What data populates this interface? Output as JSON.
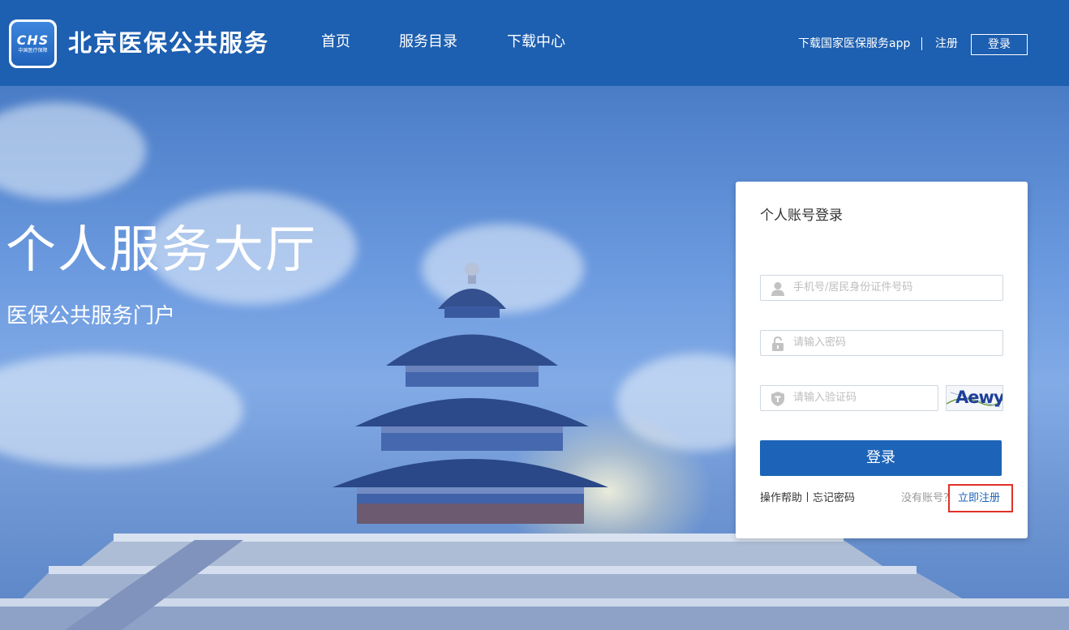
{
  "header": {
    "logo_main": "CHS",
    "logo_sub": "中国医疗保障",
    "site_title": "北京医保公共服务",
    "nav": [
      "首页",
      "服务目录",
      "下载中心"
    ],
    "download_app": "下载国家医保服务app",
    "register": "注册",
    "login": "登录"
  },
  "hero": {
    "title": "个人服务大厅",
    "subtitle": "医保公共服务门户"
  },
  "login_card": {
    "title": "个人账号登录",
    "account_placeholder": "手机号/居民身份证件号码",
    "password_placeholder": "请输入密码",
    "captcha_placeholder": "请输入验证码",
    "captcha_text": "Aewy",
    "submit_label": "登录",
    "help_label": "操作帮助",
    "forgot_label": "忘记密码",
    "no_account_label": "没有账号？",
    "register_now_label": "立即注册"
  },
  "colors": {
    "header_bg": "#1d5fb0",
    "primary_button": "#1d64b8",
    "highlight_box": "#e03127"
  }
}
